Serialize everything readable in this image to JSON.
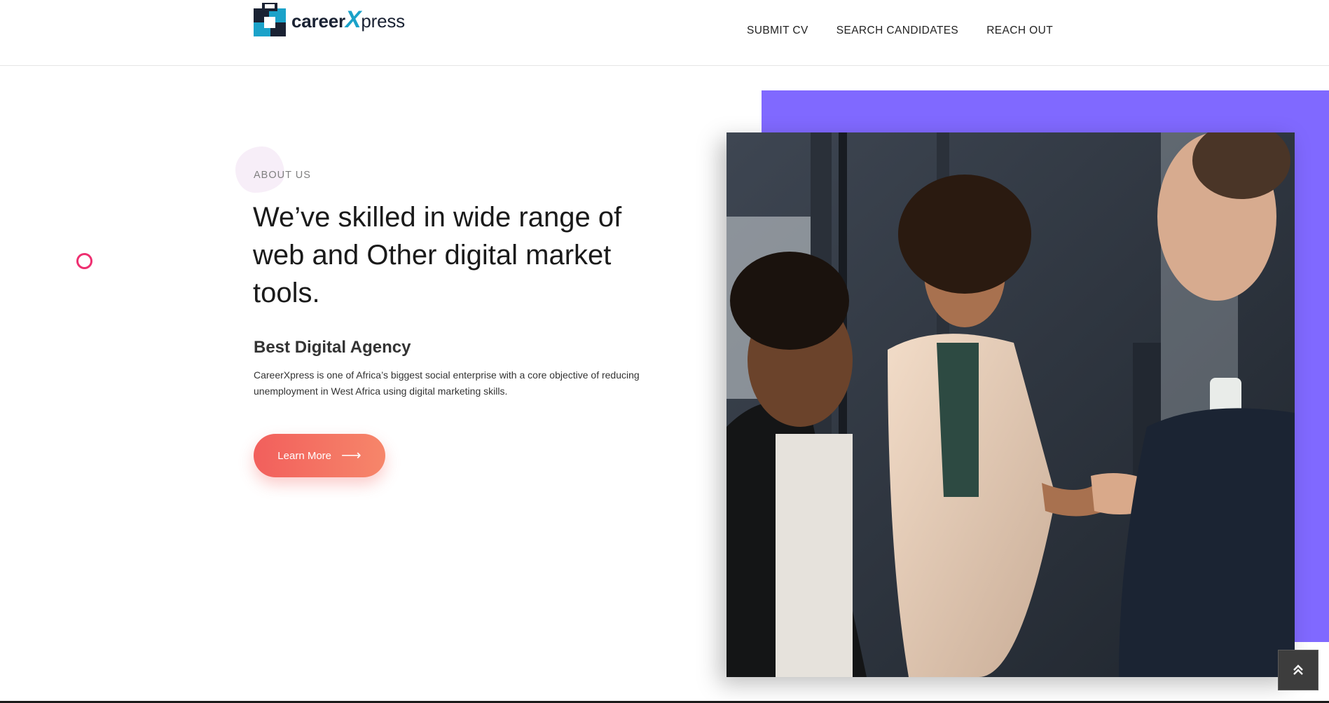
{
  "brand": {
    "text_a": "career",
    "text_x": "X",
    "text_b": "press",
    "colors": {
      "dark": "#1a2233",
      "accent": "#1ba2c9"
    }
  },
  "nav": {
    "items": [
      "SUBMIT CV",
      "SEARCH CANDIDATES",
      "REACH OUT"
    ]
  },
  "about": {
    "eyebrow": "ABOUT US",
    "headline": "We’ve skilled in wide range of web and Other digital market tools.",
    "subhead": "Best Digital Agency",
    "body": "CareerXpress is one of Africa’s biggest social enterprise with a core objective of reducing unemployment in West Africa using digital marketing skills.",
    "cta_label": "Learn More",
    "cta_arrow": "⟶"
  },
  "media": {
    "photo_icon": "team-handshake-photo"
  },
  "scroll_top": {
    "icon": "double-chevron-up-icon"
  },
  "colors": {
    "accent_purple": "#8069ff",
    "cta_start": "#f25f5c",
    "cta_end": "#f6866a",
    "deco_pink": "#ee2f70"
  }
}
